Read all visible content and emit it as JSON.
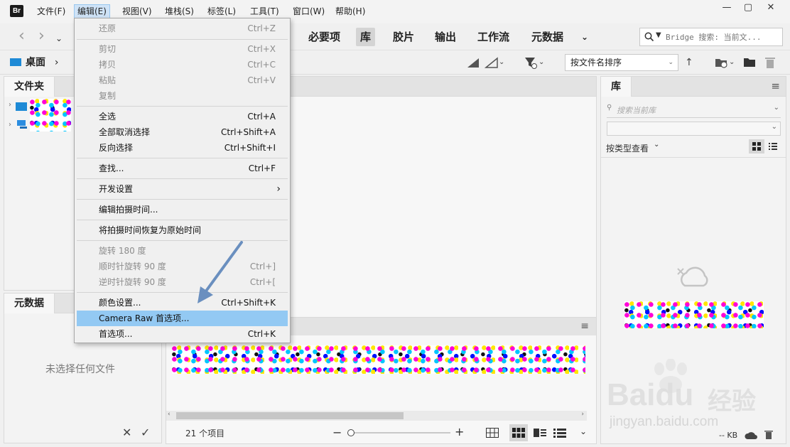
{
  "app": {
    "logo_text": "Br"
  },
  "menubar": {
    "items": [
      "文件(F)",
      "编辑(E)",
      "视图(V)",
      "堆栈(S)",
      "标签(L)",
      "工具(T)",
      "窗口(W)",
      "帮助(H)"
    ],
    "active_index": 1
  },
  "window_controls": {
    "minimize": "—",
    "maximize": "▢",
    "close": "✕"
  },
  "workspace_tabs": [
    "必要项",
    "库",
    "胶片",
    "输出",
    "工作流",
    "元数据"
  ],
  "workspace_active": "库",
  "search": {
    "placeholder": "Bridge 搜索: 当前文..."
  },
  "path": {
    "current": "桌面"
  },
  "sort": {
    "label": "按文件名排序"
  },
  "panels": {
    "folders_tab": "文件夹",
    "metadata_tab": "元数据",
    "metadata_empty": "未选择任何文件",
    "library_tab": "库",
    "library_search_placeholder": "搜索当前库",
    "library_view_by": "按类型查看",
    "library_size": "-- KB"
  },
  "content": {
    "item_count": "21 个项目"
  },
  "edit_menu": {
    "items": [
      {
        "label": "还原",
        "shortcut": "Ctrl+Z",
        "disabled": true
      },
      {
        "label": "剪切",
        "shortcut": "Ctrl+X",
        "disabled": true
      },
      {
        "label": "拷贝",
        "shortcut": "Ctrl+C",
        "disabled": true
      },
      {
        "label": "粘贴",
        "shortcut": "Ctrl+V",
        "disabled": true
      },
      {
        "label": "复制",
        "shortcut": "",
        "disabled": true
      },
      {
        "label": "全选",
        "shortcut": "Ctrl+A",
        "disabled": false
      },
      {
        "label": "全部取消选择",
        "shortcut": "Ctrl+Shift+A",
        "disabled": false
      },
      {
        "label": "反向选择",
        "shortcut": "Ctrl+Shift+I",
        "disabled": false
      },
      {
        "label": "查找...",
        "shortcut": "Ctrl+F",
        "disabled": false
      },
      {
        "label": "开发设置",
        "shortcut": "›",
        "disabled": false
      },
      {
        "label": "编辑拍摄时间...",
        "shortcut": "",
        "disabled": false
      },
      {
        "label": "将拍摄时间恢复为原始时间",
        "shortcut": "",
        "disabled": false
      },
      {
        "label": "旋转 180 度",
        "shortcut": "",
        "disabled": true
      },
      {
        "label": "顺时针旋转 90 度",
        "shortcut": "Ctrl+]",
        "disabled": true
      },
      {
        "label": "逆时针旋转 90 度",
        "shortcut": "Ctrl+[",
        "disabled": true
      },
      {
        "label": "颜色设置...",
        "shortcut": "Ctrl+Shift+K",
        "disabled": false
      },
      {
        "label": "Camera Raw 首选项...",
        "shortcut": "",
        "disabled": false,
        "highlighted": true
      },
      {
        "label": "首选项...",
        "shortcut": "Ctrl+K",
        "disabled": false
      }
    ]
  },
  "watermark": {
    "brand": "Baidu",
    "cn": "经验",
    "url": "jingyan.baidu.com"
  },
  "colors": {
    "highlight": "#93c9f3",
    "arrow": "#6a8fbf",
    "folder_blue": "#1e8ad6"
  }
}
